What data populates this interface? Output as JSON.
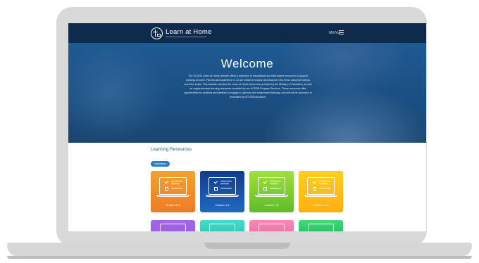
{
  "header": {
    "brand": "Learn at Home",
    "menu_label": "MENU"
  },
  "hero": {
    "title": "Welcome",
    "text": "The HCDSB Learn at Home website offers a collection of educational and faith-based resources to support learning at home. Parents and students in K-12 are invited to browse and discover new items using the buttons and links below. This website includes the Learn at Home resources provided by the Ministry of Education, as well as supplementary learning resources compiled by our HCDSB Program Services. These resources offer opportunities for students and families to engage in optional and independent learning, and will not be assessed or evaluated by HCDSB educators."
  },
  "resources": {
    "title": "Learning Resources",
    "filter_label": "Disclaimer",
    "cards": [
      {
        "label": "Grades K-3"
      },
      {
        "label": "Grades 4-6"
      },
      {
        "label": "Grades 7-8"
      },
      {
        "label": "Grades 9-12"
      }
    ]
  },
  "colors": {
    "header_bg": "#0e2b4c",
    "hero_bg": "#1f5a92",
    "card_orange": "#f3a22e",
    "card_blue": "#1f6ac0",
    "card_green": "#7ccf33",
    "card_yellow": "#ffc11a"
  },
  "icons": [
    "logo-cross-icon",
    "hamburger-menu-icon",
    "laptop-checklist-icon"
  ]
}
